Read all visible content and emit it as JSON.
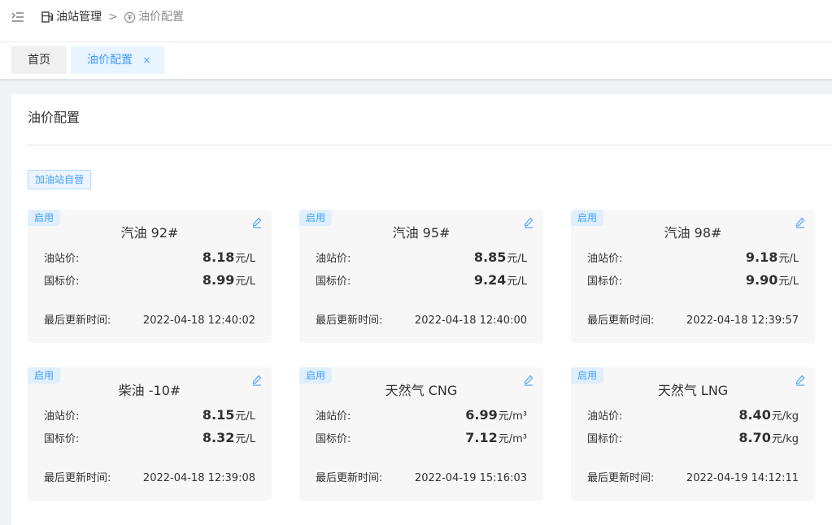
{
  "breadcrumb": {
    "item1": "油站管理",
    "separator": ">",
    "item2": "油价配置"
  },
  "tabs": [
    {
      "label": "首页"
    },
    {
      "label": "油价配置",
      "close": "×"
    }
  ],
  "panel": {
    "title": "油价配置",
    "self_operated_button": "加油站自营"
  },
  "labels": {
    "station_price": "油站价:",
    "national_price": "国标价:",
    "last_update": "最后更新时间:"
  },
  "colors": {
    "accent": "#409eff",
    "badge_bg": "#dfeffd",
    "card_bg": "#f7f7f8"
  },
  "cards": [
    {
      "status": "启用",
      "name": "汽油 92#",
      "station_price": "8.18",
      "national_price": "8.99",
      "unit": "元/L",
      "updated": "2022-04-18 12:40:02"
    },
    {
      "status": "启用",
      "name": "汽油 95#",
      "station_price": "8.85",
      "national_price": "9.24",
      "unit": "元/L",
      "updated": "2022-04-18 12:40:00"
    },
    {
      "status": "启用",
      "name": "汽油 98#",
      "station_price": "9.18",
      "national_price": "9.90",
      "unit": "元/L",
      "updated": "2022-04-18 12:39:57"
    },
    {
      "status": "启用",
      "name": "柴油 -10#",
      "station_price": "8.15",
      "national_price": "8.32",
      "unit": "元/L",
      "updated": "2022-04-18 12:39:08"
    },
    {
      "status": "启用",
      "name": "天然气 CNG",
      "station_price": "6.99",
      "national_price": "7.12",
      "unit": "元/m³",
      "updated": "2022-04-19 15:16:03"
    },
    {
      "status": "启用",
      "name": "天然气 LNG",
      "station_price": "8.40",
      "national_price": "8.70",
      "unit": "元/kg",
      "updated": "2022-04-19 14:12:11"
    }
  ]
}
